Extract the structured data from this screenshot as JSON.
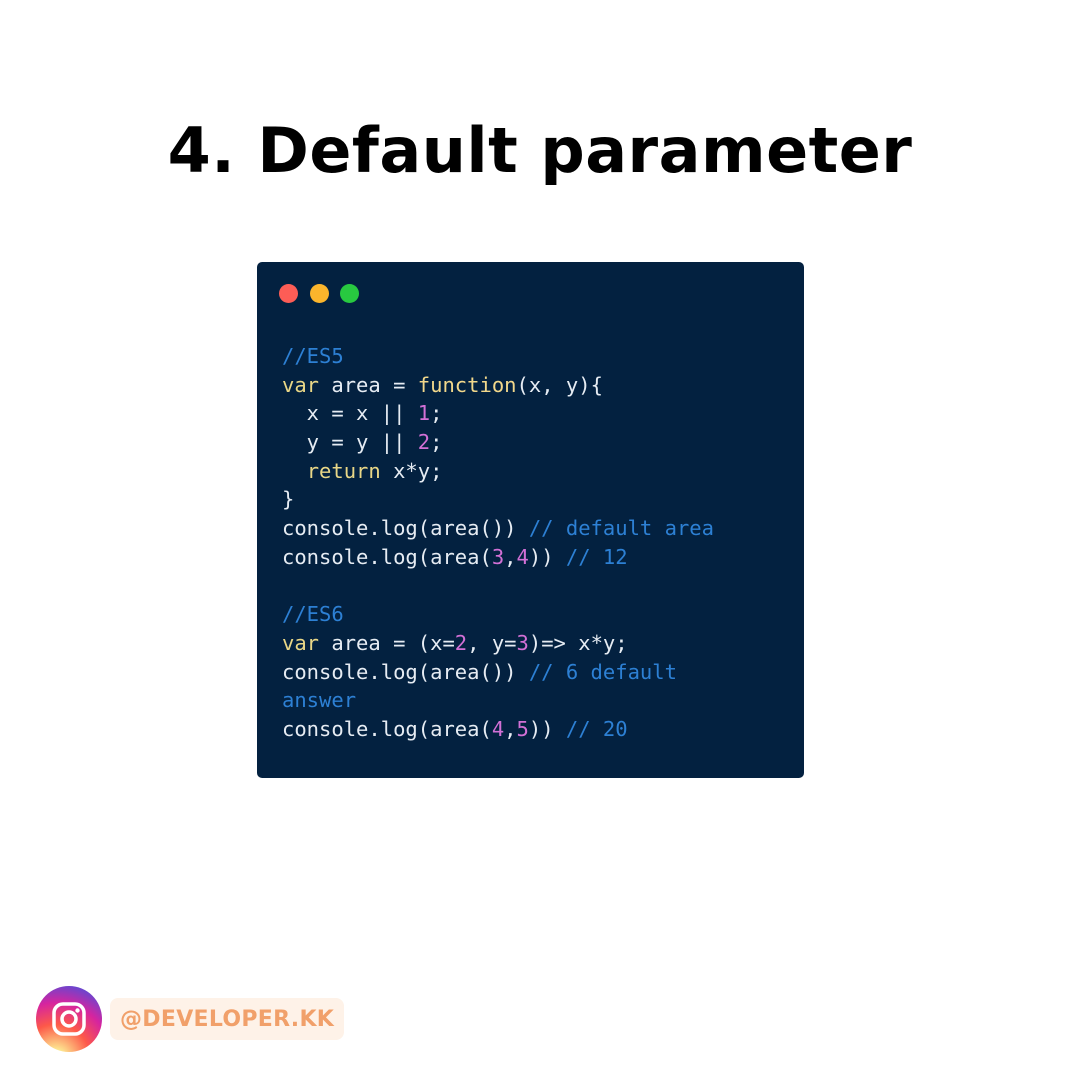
{
  "title": "4. Default parameter",
  "colors": {
    "code_background": "#032140",
    "comment": "#2d80d4",
    "keyword": "#e9d787",
    "number": "#d270d6",
    "text": "#e6ecf3",
    "dot_red": "#fd5d56",
    "dot_yellow": "#fbb52c",
    "dot_green": "#28c940",
    "handle_text": "#f1a06a",
    "handle_background": "#fef2e8"
  },
  "window_controls": [
    "close-dot",
    "minimize-dot",
    "maximize-dot"
  ],
  "code_lines": [
    [
      {
        "t": "//ES5",
        "c": "comment"
      }
    ],
    [
      {
        "t": "var",
        "c": "keyword"
      },
      {
        "t": " area = ",
        "c": "plain"
      },
      {
        "t": "function",
        "c": "func"
      },
      {
        "t": "(x, y){",
        "c": "plain"
      }
    ],
    [
      {
        "t": "  x = x || ",
        "c": "plain"
      },
      {
        "t": "1",
        "c": "number"
      },
      {
        "t": ";",
        "c": "plain"
      }
    ],
    [
      {
        "t": "  y = y || ",
        "c": "plain"
      },
      {
        "t": "2",
        "c": "number"
      },
      {
        "t": ";",
        "c": "plain"
      }
    ],
    [
      {
        "t": "  ",
        "c": "plain"
      },
      {
        "t": "return",
        "c": "keyword"
      },
      {
        "t": " x*y;",
        "c": "plain"
      }
    ],
    [
      {
        "t": "}",
        "c": "plain"
      }
    ],
    [
      {
        "t": "console.log(area()) ",
        "c": "plain"
      },
      {
        "t": "// default area",
        "c": "comment"
      }
    ],
    [
      {
        "t": "console.log(area(",
        "c": "plain"
      },
      {
        "t": "3",
        "c": "number"
      },
      {
        "t": ",",
        "c": "plain"
      },
      {
        "t": "4",
        "c": "number"
      },
      {
        "t": ")) ",
        "c": "plain"
      },
      {
        "t": "// 12",
        "c": "comment"
      }
    ],
    [],
    [
      {
        "t": "//ES6",
        "c": "comment"
      }
    ],
    [
      {
        "t": "var",
        "c": "keyword"
      },
      {
        "t": " area = (x=",
        "c": "plain"
      },
      {
        "t": "2",
        "c": "number"
      },
      {
        "t": ", y=",
        "c": "plain"
      },
      {
        "t": "3",
        "c": "number"
      },
      {
        "t": ")=> x*y;",
        "c": "plain"
      }
    ],
    [
      {
        "t": "console.log(area()) ",
        "c": "plain"
      },
      {
        "t": "// 6 default",
        "c": "comment"
      }
    ],
    [
      {
        "t": "answer",
        "c": "comment"
      }
    ],
    [
      {
        "t": "console.log(area(",
        "c": "plain"
      },
      {
        "t": "4",
        "c": "number"
      },
      {
        "t": ",",
        "c": "plain"
      },
      {
        "t": "5",
        "c": "number"
      },
      {
        "t": ")) ",
        "c": "plain"
      },
      {
        "t": "// 20",
        "c": "comment"
      }
    ]
  ],
  "footer": {
    "icon": "instagram-icon",
    "handle": "@DEVELOPER.KK"
  }
}
